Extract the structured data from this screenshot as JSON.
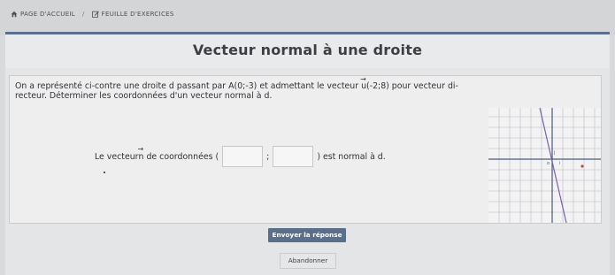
{
  "breadcrumb": {
    "home_label": "PAGE D'ACCUEIL",
    "separator": "/",
    "sheet_label": "FEUILLE D'EXERCICES"
  },
  "exercise": {
    "title": "Vecteur normal à une droite",
    "statement": "On a représenté ci-contre une droite d passant par A(0;-3) et admettant le vecteur ",
    "statement_vector": "u",
    "statement_end_1": "(-2;8) pour vecteur di-",
    "statement_end_2": "recteur. Déterminer les coordonnées d'un vecteur normal à d.",
    "question_prefix": "Le vecteur ",
    "question_vector": "n",
    "question_mid": " de coordonnées (",
    "question_sep": ";",
    "question_suffix": ") est normal à d.",
    "answer_x": "",
    "answer_y": ""
  },
  "buttons": {
    "submit": "Envoyer la réponse",
    "abandon": "Abandonner"
  },
  "graph": {
    "label_j": "j",
    "label_o": "o",
    "label_i": "i",
    "line_color": "#7a5fb0",
    "axis_color": "#4b5b78",
    "point_color": "#c8453c"
  }
}
